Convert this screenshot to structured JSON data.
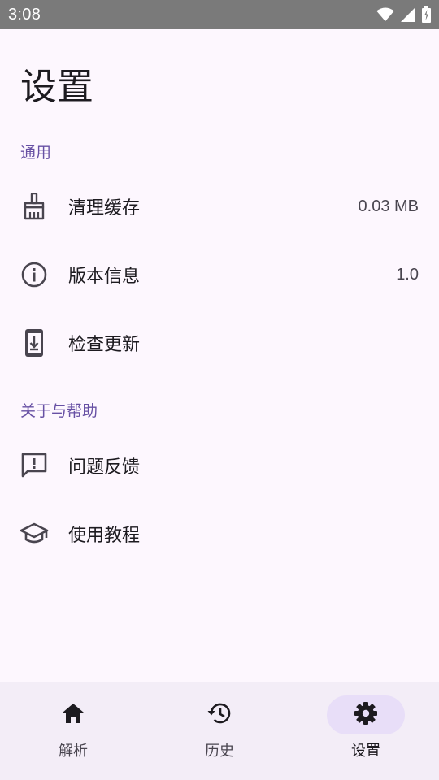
{
  "status_bar": {
    "time": "3:08",
    "icons": [
      "wifi-icon",
      "signal-icon",
      "battery-charging-icon"
    ]
  },
  "page": {
    "title": "设置"
  },
  "sections": [
    {
      "header": "通用",
      "items": [
        {
          "icon": "broom-icon",
          "label": "清理缓存",
          "value": "0.03 MB"
        },
        {
          "icon": "info-icon",
          "label": "版本信息",
          "value": "1.0"
        },
        {
          "icon": "phone-download-icon",
          "label": "检查更新",
          "value": ""
        }
      ]
    },
    {
      "header": "关于与帮助",
      "items": [
        {
          "icon": "feedback-icon",
          "label": "问题反馈",
          "value": ""
        },
        {
          "icon": "school-icon",
          "label": "使用教程",
          "value": ""
        }
      ]
    }
  ],
  "bottom_nav": {
    "items": [
      {
        "icon": "home-icon",
        "label": "解析",
        "active": false
      },
      {
        "icon": "history-icon",
        "label": "历史",
        "active": false
      },
      {
        "icon": "gear-icon",
        "label": "设置",
        "active": true
      }
    ]
  },
  "colors": {
    "background": "#fdf7fe",
    "accent": "#6750a4",
    "nav_background": "#f3edf7",
    "active_pill": "#e8def8",
    "status_bar": "#7a7a7a"
  }
}
